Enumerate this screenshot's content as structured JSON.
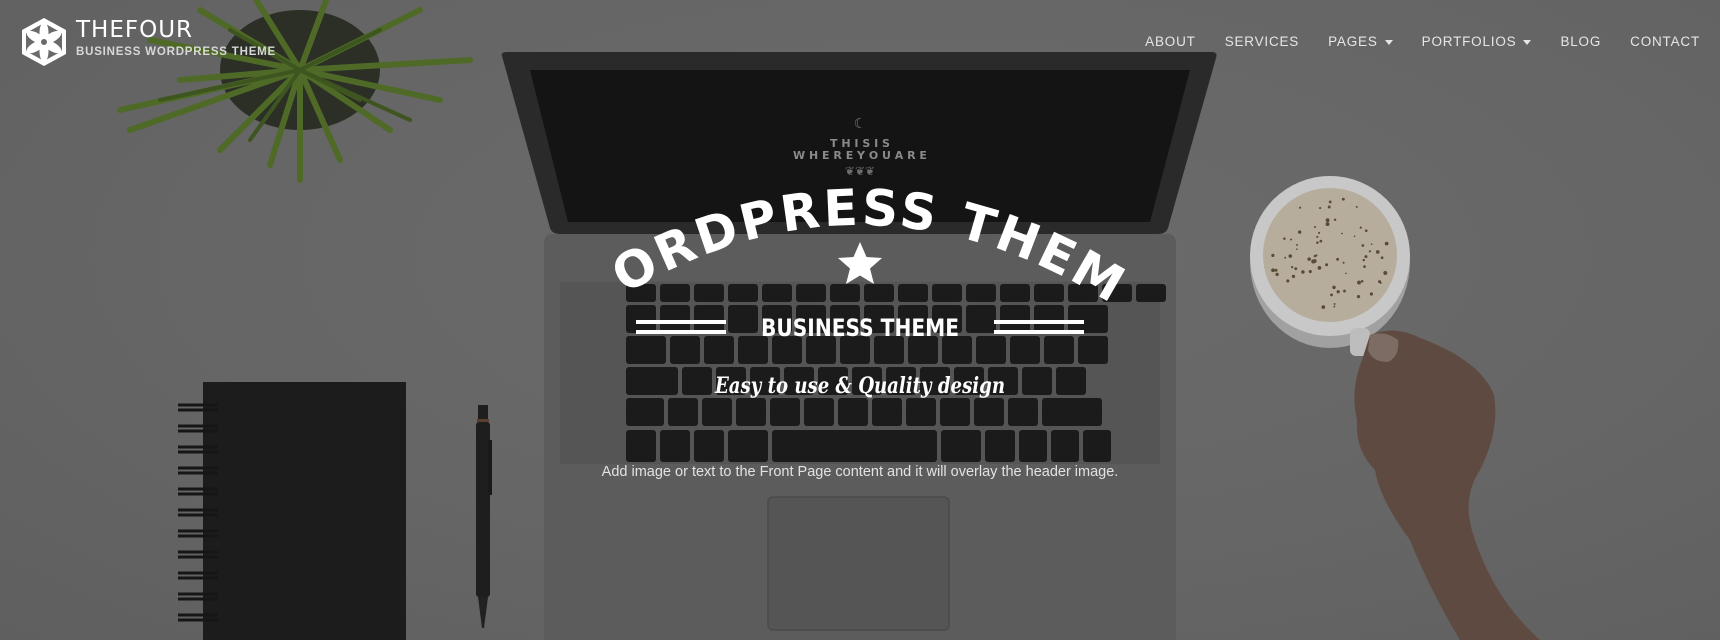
{
  "header": {
    "logo": {
      "icon": "hexagon-flower-logo-icon",
      "title": "THEFOUR",
      "tagline": "BUSINESS WORDPRESS THEME"
    },
    "nav": [
      {
        "label": "ABOUT",
        "has_dropdown": false
      },
      {
        "label": "SERVICES",
        "has_dropdown": false
      },
      {
        "label": "PAGES",
        "has_dropdown": true
      },
      {
        "label": "PORTFOLIOS",
        "has_dropdown": true
      },
      {
        "label": "BLOG",
        "has_dropdown": false
      },
      {
        "label": "CONTACT",
        "has_dropdown": false
      }
    ]
  },
  "hero": {
    "screen_text": {
      "line1": "T H I S   I S",
      "line2": "W H E R E   Y O U   A R E"
    },
    "badge": {
      "arc_title": "WORDPRESS THEME",
      "subtitle": "BUSINESS THEME",
      "tagline": "Easy to use  &  Quality design",
      "icon": "star-icon"
    },
    "overlay_text": "Add image or text to the Front Page content and it will overlay the header image."
  },
  "colors": {
    "background": "#666666",
    "nav_text": "#e6e6e6",
    "badge_text": "#ffffff"
  }
}
